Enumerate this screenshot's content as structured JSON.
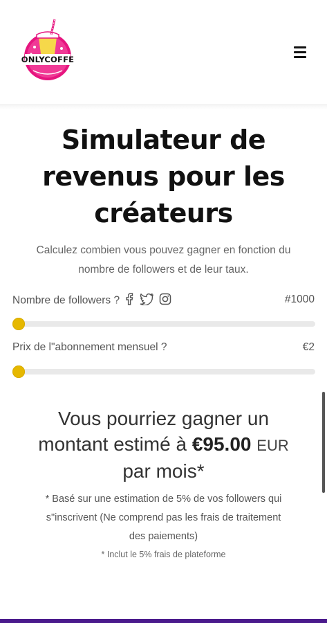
{
  "header": {
    "logo_text": "ONLYCOFFE",
    "menu_icon": "hamburger-menu-icon"
  },
  "main": {
    "title_lines": [
      "Simulateur de",
      "revenus pour les",
      "créateurs"
    ],
    "subtitle_lines": [
      "Calculez combien vous pouvez gagner en fonction du",
      "nombre de followers et de leur taux."
    ],
    "followers": {
      "label": "Nombre de followers ?",
      "icons": [
        "facebook-icon",
        "twitter-icon",
        "instagram-icon"
      ],
      "value": "#1000",
      "slider_level": 0
    },
    "price": {
      "label": "Prix de l\"abonnement mensuel ?",
      "value": "€2",
      "slider_level": 0
    },
    "result": {
      "line1": "Vous pourriez gagner un",
      "line2_prefix": "montant estimé à ",
      "amount": "€95.00",
      "currency": "EUR",
      "line3": "par mois*"
    },
    "note_lines": [
      "* Basé sur une estimation de 5% de vos followers qui",
      "s\"inscrivent (Ne comprend pas les frais de traitement",
      "des paiements)"
    ],
    "fee_note": "* Inclut le 5% frais de plateforme"
  },
  "colors": {
    "accent_slider": "#e6b800",
    "logo_pink": "#e6157f",
    "bottom_bar": "#4a1a8c"
  }
}
